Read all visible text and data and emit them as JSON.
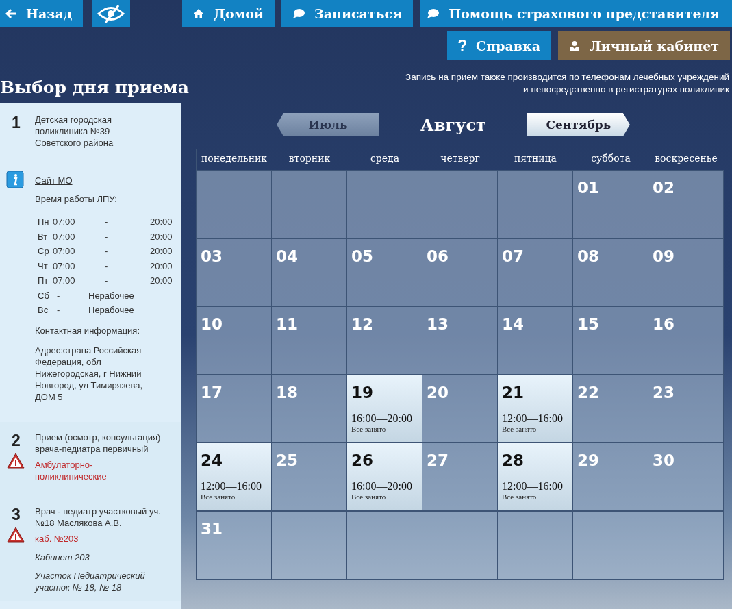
{
  "nav_top": [
    {
      "kind": "back",
      "label": "Назад"
    },
    {
      "kind": "eye"
    },
    {
      "kind": "home",
      "label": "Домой"
    },
    {
      "kind": "chat",
      "label": "Записаться"
    },
    {
      "kind": "chat",
      "label": "Помощь страхового представителя"
    }
  ],
  "nav_second": [
    {
      "kind": "help",
      "label": "Справка"
    },
    {
      "kind": "user",
      "label": "Личный кабинет"
    }
  ],
  "page_title": "Выбор дня приема",
  "notice": [
    "Запись на прием также производится по телефонам лечебных учреждений",
    "и непосредственно в регистратурах поликлиник"
  ],
  "steps": [
    {
      "number": "1",
      "title": "Детская городская поликлиника №39 Советского района",
      "site_link": "Сайт МО",
      "hours_label": "Время работы ЛПУ:",
      "hours": [
        {
          "kind": "open",
          "day": "Пн",
          "from": "07:00",
          "dash": "-",
          "to": "20:00"
        },
        {
          "kind": "open",
          "day": "Вт",
          "from": "07:00",
          "dash": "-",
          "to": "20:00"
        },
        {
          "kind": "open",
          "day": "Ср",
          "from": "07:00",
          "dash": "-",
          "to": "20:00"
        },
        {
          "kind": "open",
          "day": "Чт",
          "from": "07:00",
          "dash": "-",
          "to": "20:00"
        },
        {
          "kind": "open",
          "day": "Пт",
          "from": "07:00",
          "dash": "-",
          "to": "20:00"
        },
        {
          "kind": "closed",
          "day": "Сб",
          "dash": "-",
          "status": "Нерабочее"
        },
        {
          "kind": "closed",
          "day": "Вс",
          "dash": "-",
          "status": "Нерабочее"
        }
      ],
      "contact_label": "Контактная информация:",
      "address": "Адрес:страна Российская Федерация, обл Нижегородская, г Нижний Новгород, ул Тимирязева, ДОМ 5"
    },
    {
      "number": "2",
      "title": "Прием (осмотр, консультация) врача-педиатра первичный",
      "warning": true,
      "note": "Амбулаторно-поликлинические"
    },
    {
      "number": "3",
      "title": "Врач - педиатр участковый уч. №18 Маслякова А.В.",
      "warning": true,
      "note": "каб. №203",
      "extra": [
        "Кабинет 203",
        "Участок Педиатрический участок № 18, № 18"
      ]
    }
  ],
  "calendar": {
    "prev_month": "Июль",
    "month": "Август",
    "next_month": "Сентябрь",
    "weekdays": [
      "понедельник",
      "вторник",
      "среда",
      "четверг",
      "пятница",
      "суббота",
      "воскресенье"
    ],
    "weeks": [
      [
        {
          "kind": "empty"
        },
        {
          "kind": "empty"
        },
        {
          "kind": "empty"
        },
        {
          "kind": "empty"
        },
        {
          "kind": "empty"
        },
        {
          "kind": "day",
          "day": "01"
        },
        {
          "kind": "day",
          "day": "02"
        }
      ],
      [
        {
          "kind": "day",
          "day": "03"
        },
        {
          "kind": "day",
          "day": "04"
        },
        {
          "kind": "day",
          "day": "05"
        },
        {
          "kind": "day",
          "day": "06"
        },
        {
          "kind": "day",
          "day": "07"
        },
        {
          "kind": "day",
          "day": "08"
        },
        {
          "kind": "day",
          "day": "09"
        }
      ],
      [
        {
          "kind": "day",
          "day": "10"
        },
        {
          "kind": "day",
          "day": "11"
        },
        {
          "kind": "day",
          "day": "12"
        },
        {
          "kind": "day",
          "day": "13"
        },
        {
          "kind": "day",
          "day": "14"
        },
        {
          "kind": "day",
          "day": "15"
        },
        {
          "kind": "day",
          "day": "16"
        }
      ],
      [
        {
          "kind": "day",
          "day": "17"
        },
        {
          "kind": "day",
          "day": "18"
        },
        {
          "kind": "slot",
          "day": "19",
          "time": "16:00—20:00",
          "status": "Все занято"
        },
        {
          "kind": "day",
          "day": "20"
        },
        {
          "kind": "slot",
          "day": "21",
          "time": "12:00—16:00",
          "status": "Все занято"
        },
        {
          "kind": "day",
          "day": "22"
        },
        {
          "kind": "day",
          "day": "23"
        }
      ],
      [
        {
          "kind": "slot",
          "day": "24",
          "time": "12:00—16:00",
          "status": "Все занято"
        },
        {
          "kind": "day",
          "day": "25"
        },
        {
          "kind": "slot",
          "day": "26",
          "time": "16:00—20:00",
          "status": "Все занято"
        },
        {
          "kind": "day",
          "day": "27"
        },
        {
          "kind": "slot",
          "day": "28",
          "time": "12:00—16:00",
          "status": "Все занято"
        },
        {
          "kind": "day",
          "day": "29"
        },
        {
          "kind": "day",
          "day": "30"
        }
      ],
      [
        {
          "kind": "day",
          "day": "31"
        },
        {
          "kind": "empty"
        },
        {
          "kind": "empty"
        },
        {
          "kind": "empty"
        },
        {
          "kind": "empty"
        },
        {
          "kind": "empty"
        },
        {
          "kind": "empty"
        }
      ]
    ]
  }
}
